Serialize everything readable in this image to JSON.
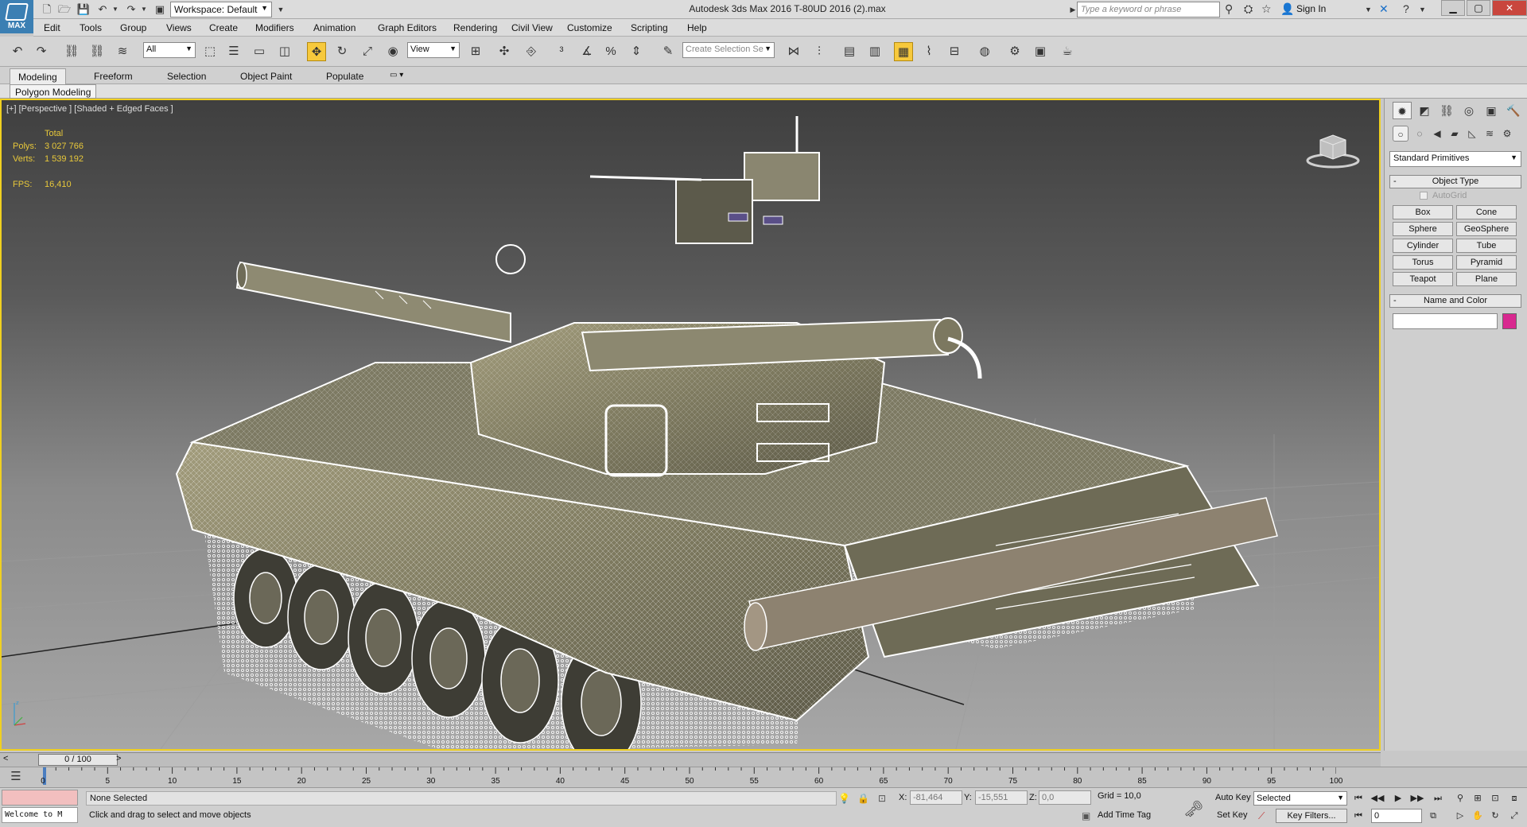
{
  "app": {
    "logo_text": "MAX",
    "workspace_label": "Workspace: Default",
    "title": "Autodesk 3ds Max 2016     T-80UD 2016 (2).max",
    "search_placeholder": "Type a keyword or phrase",
    "sign_in": "Sign In"
  },
  "menu": [
    "Edit",
    "Tools",
    "Group",
    "Views",
    "Create",
    "Modifiers",
    "Animation",
    "Graph Editors",
    "Rendering",
    "Civil View",
    "Customize",
    "Scripting",
    "Help"
  ],
  "toolbar": {
    "selection_filter": "All",
    "reference_coord": "View",
    "selection_set_placeholder": "Create Selection Se"
  },
  "ribbon": {
    "tabs": [
      "Modeling",
      "Freeform",
      "Selection",
      "Object Paint",
      "Populate"
    ],
    "active_tab": "Modeling",
    "panel_label": "Polygon Modeling"
  },
  "viewport": {
    "label": "[+] [Perspective ] [Shaded + Edged Faces ]",
    "stats": {
      "total_label": "Total",
      "polys_label": "Polys:",
      "polys_value": "3 027 766",
      "verts_label": "Verts:",
      "verts_value": "1 539 192",
      "fps_label": "FPS:",
      "fps_value": "16,410"
    },
    "colors": {
      "border_active": "#f0d020",
      "stats_text": "#e8c83a",
      "wire": "#ffffff",
      "body": "#8a8466"
    }
  },
  "command_panel": {
    "category": "Standard Primitives",
    "object_type_title": "Object Type",
    "autogrid_label": "AutoGrid",
    "buttons": [
      "Box",
      "Cone",
      "Sphere",
      "GeoSphere",
      "Cylinder",
      "Tube",
      "Torus",
      "Pyramid",
      "Teapot",
      "Plane"
    ],
    "name_color_title": "Name and Color",
    "name_value": "",
    "swatch_color": "#d8288f"
  },
  "timeline": {
    "frame_range": "0 / 100",
    "ticks": [
      "0",
      "5",
      "10",
      "15",
      "20",
      "25",
      "30",
      "35",
      "40",
      "45",
      "50",
      "55",
      "60",
      "65",
      "70",
      "75",
      "80",
      "85",
      "90",
      "95",
      "100"
    ]
  },
  "status": {
    "welcome": "Welcome to M",
    "selection": "None Selected",
    "prompt": "Click and drag to select and move objects",
    "x_label": "X:",
    "x_value": "-81,464",
    "y_label": "Y:",
    "y_value": "-15,551",
    "z_label": "Z:",
    "z_value": "0,0",
    "grid": "Grid = 10,0",
    "add_time_tag": "Add Time Tag",
    "auto_key": "Auto Key",
    "set_key": "Set Key",
    "key_mode": "Selected",
    "key_filters": "Key Filters...",
    "current_frame": "0"
  }
}
